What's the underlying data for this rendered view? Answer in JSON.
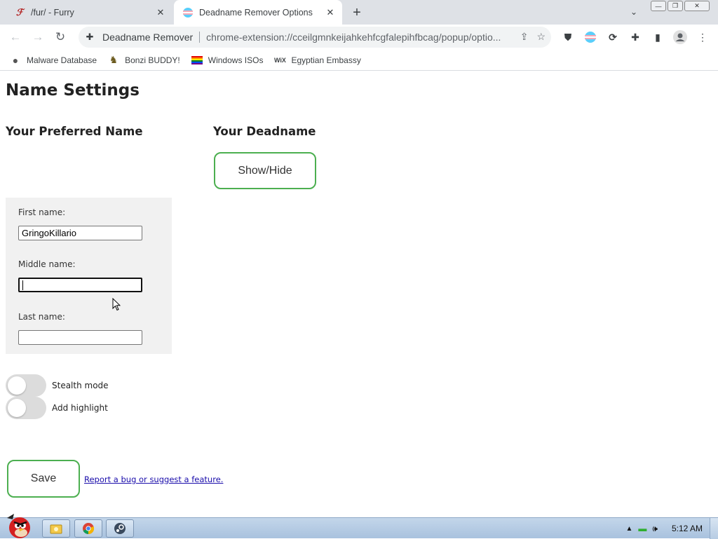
{
  "tabs": [
    {
      "title": "/fur/ - Furry",
      "favicon": "4chan-fur-icon",
      "active": false
    },
    {
      "title": "Deadname Remover Options",
      "favicon": "trans-flag-icon",
      "active": true
    }
  ],
  "window_controls": {
    "minimize": "—",
    "restore": "❐",
    "close": "✕"
  },
  "toolbar": {
    "origin": "Deadname Remover",
    "url": "chrome-extension://cceilgmnkeijahkehfcgfalepihfbcag/popup/optio..."
  },
  "bookmarks": [
    {
      "label": "Malware Database",
      "icon": "globe-icon"
    },
    {
      "label": "Bonzi BUDDY!",
      "icon": "bonzi-icon"
    },
    {
      "label": "Windows ISOs",
      "icon": "pride-flag-icon"
    },
    {
      "label": "Egyptian Embassy",
      "icon": "wix-icon"
    }
  ],
  "page": {
    "title": "Name Settings",
    "preferred_heading": "Your Preferred Name",
    "deadname_heading": "Your Deadname",
    "show_hide_label": "Show/Hide",
    "fields": {
      "first": {
        "label": "First name:",
        "value": "GringoKillario"
      },
      "middle": {
        "label": "Middle name:",
        "value": ""
      },
      "last": {
        "label": "Last name:",
        "value": ""
      }
    },
    "toggles": [
      {
        "label": "Stealth mode",
        "on": false
      },
      {
        "label": "Add highlight",
        "on": false
      }
    ],
    "save_label": "Save",
    "bug_link": "Report a bug or suggest a feature."
  },
  "taskbar": {
    "clock": "5:12 AM",
    "apps": [
      "explorer-icon",
      "chrome-icon",
      "steam-icon"
    ]
  },
  "colors": {
    "accent_border": "#4caf50",
    "link": "#1a0dab"
  }
}
